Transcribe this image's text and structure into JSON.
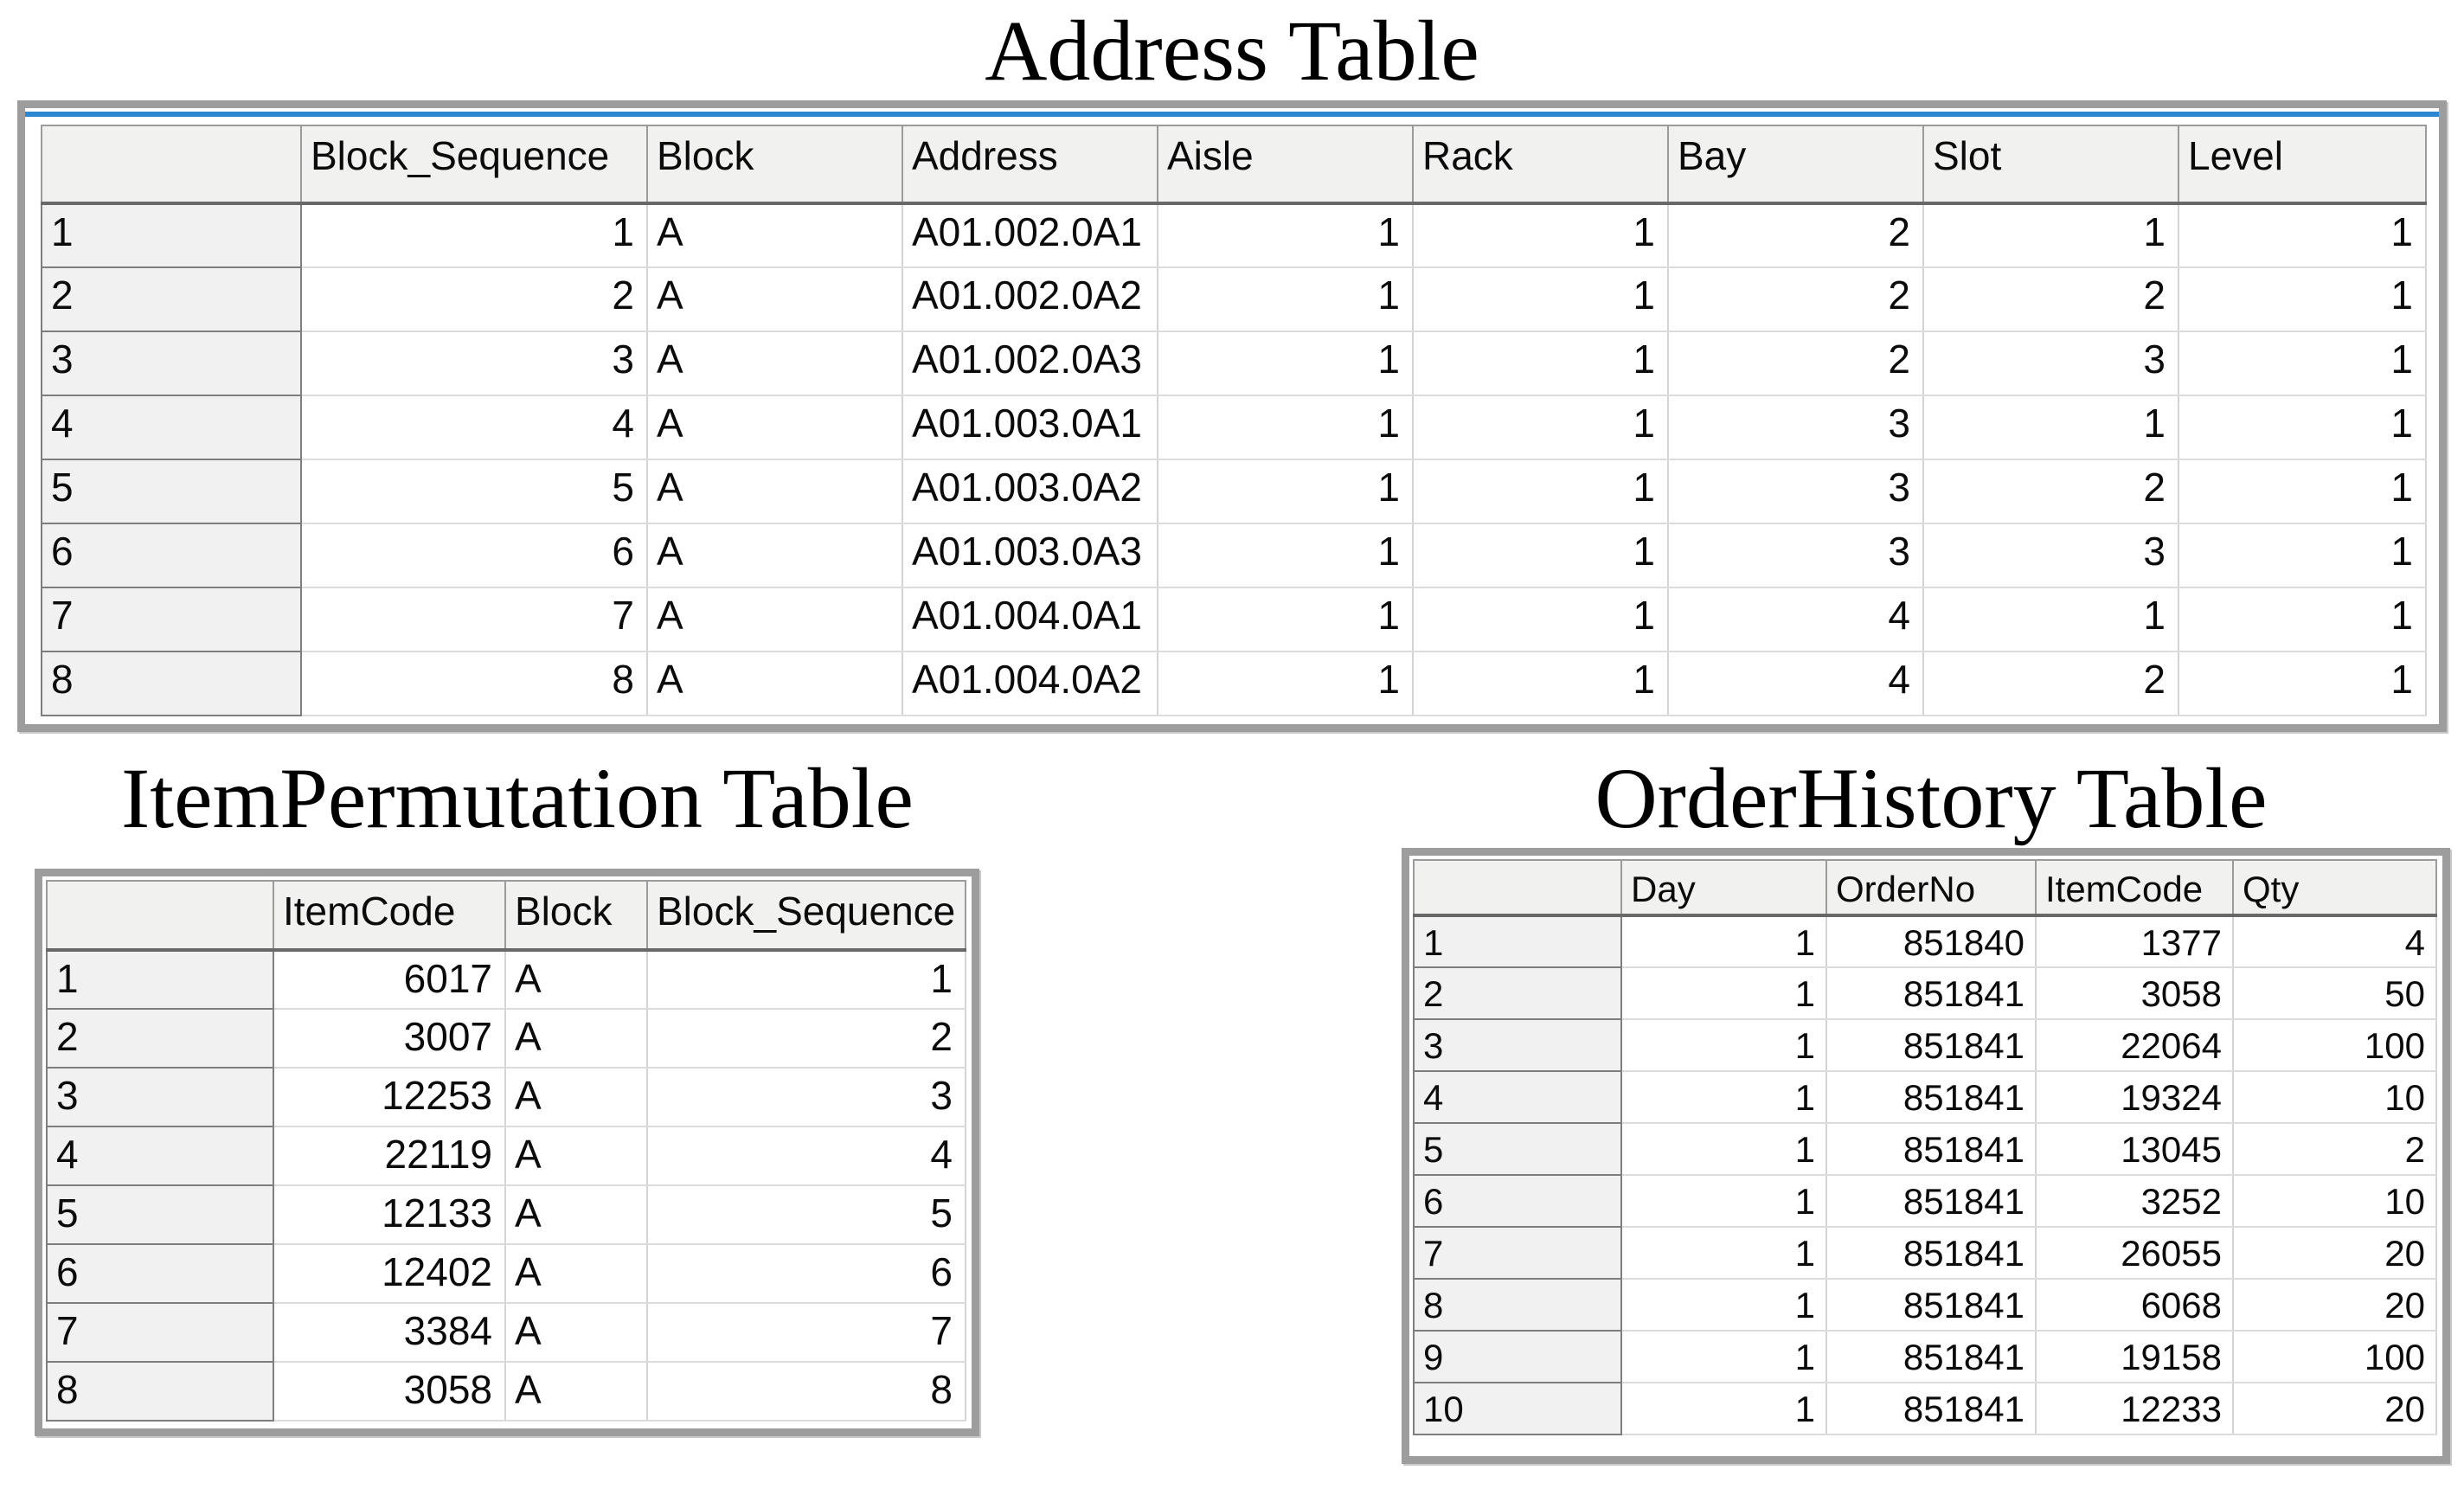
{
  "colors": {
    "accent_blue": "#2b87d2",
    "frame_gray": "#9d9d9d",
    "header_bg": "#f1f1ef",
    "row_header_bg": "#f1f1f1",
    "grid_line_light": "#d4d4d4",
    "grid_line_dark": "#686868"
  },
  "tables": {
    "address": {
      "title": "Address Table",
      "columns": [
        "",
        "Block_Sequence",
        "Block",
        "Address",
        "Aisle",
        "Rack",
        "Bay",
        "Slot",
        "Level"
      ],
      "rows": [
        [
          "1",
          "1",
          "A",
          "A01.002.0A1",
          "1",
          "1",
          "2",
          "1",
          "1"
        ],
        [
          "2",
          "2",
          "A",
          "A01.002.0A2",
          "1",
          "1",
          "2",
          "2",
          "1"
        ],
        [
          "3",
          "3",
          "A",
          "A01.002.0A3",
          "1",
          "1",
          "2",
          "3",
          "1"
        ],
        [
          "4",
          "4",
          "A",
          "A01.003.0A1",
          "1",
          "1",
          "3",
          "1",
          "1"
        ],
        [
          "5",
          "5",
          "A",
          "A01.003.0A2",
          "1",
          "1",
          "3",
          "2",
          "1"
        ],
        [
          "6",
          "6",
          "A",
          "A01.003.0A3",
          "1",
          "1",
          "3",
          "3",
          "1"
        ],
        [
          "7",
          "7",
          "A",
          "A01.004.0A1",
          "1",
          "1",
          "4",
          "1",
          "1"
        ],
        [
          "8",
          "8",
          "A",
          "A01.004.0A2",
          "1",
          "1",
          "4",
          "2",
          "1"
        ]
      ]
    },
    "item_permutation": {
      "title": "ItemPermutation Table",
      "columns": [
        "",
        "ItemCode",
        "Block",
        "Block_Sequence"
      ],
      "rows": [
        [
          "1",
          "6017",
          "A",
          "1"
        ],
        [
          "2",
          "3007",
          "A",
          "2"
        ],
        [
          "3",
          "12253",
          "A",
          "3"
        ],
        [
          "4",
          "22119",
          "A",
          "4"
        ],
        [
          "5",
          "12133",
          "A",
          "5"
        ],
        [
          "6",
          "12402",
          "A",
          "6"
        ],
        [
          "7",
          "3384",
          "A",
          "7"
        ],
        [
          "8",
          "3058",
          "A",
          "8"
        ]
      ]
    },
    "order_history": {
      "title": "OrderHistory Table",
      "columns": [
        "",
        "Day",
        "OrderNo",
        "ItemCode",
        "Qty"
      ],
      "rows": [
        [
          "1",
          "1",
          "851840",
          "1377",
          "4"
        ],
        [
          "2",
          "1",
          "851841",
          "3058",
          "50"
        ],
        [
          "3",
          "1",
          "851841",
          "22064",
          "100"
        ],
        [
          "4",
          "1",
          "851841",
          "19324",
          "10"
        ],
        [
          "5",
          "1",
          "851841",
          "13045",
          "2"
        ],
        [
          "6",
          "1",
          "851841",
          "3252",
          "10"
        ],
        [
          "7",
          "1",
          "851841",
          "26055",
          "20"
        ],
        [
          "8",
          "1",
          "851841",
          "6068",
          "20"
        ],
        [
          "9",
          "1",
          "851841",
          "19158",
          "100"
        ],
        [
          "10",
          "1",
          "851841",
          "12233",
          "20"
        ]
      ]
    }
  }
}
